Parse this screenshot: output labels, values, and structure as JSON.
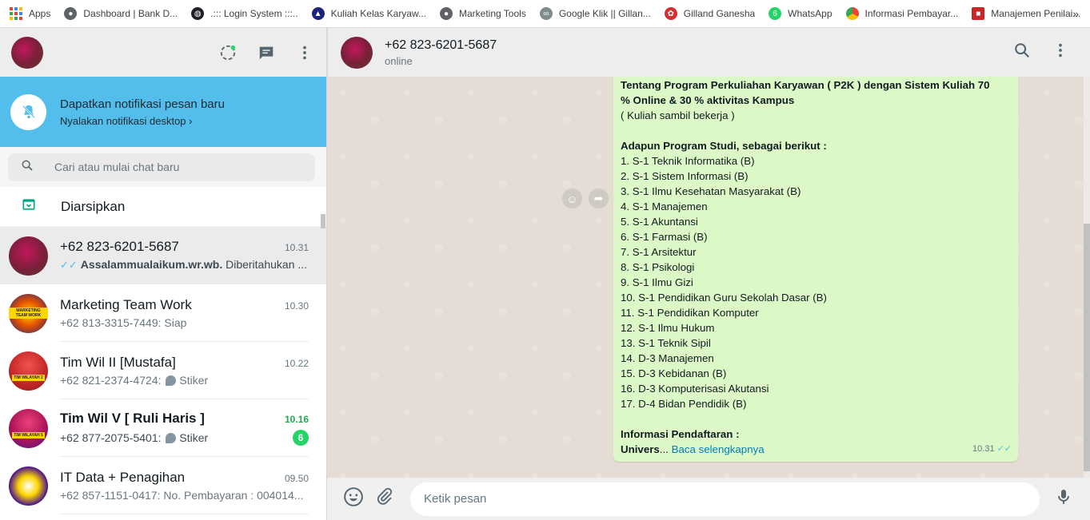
{
  "bookmarks": {
    "apps_label": "Apps",
    "items": [
      {
        "label": "Dashboard | Bank D...",
        "icon": "hat-icon",
        "color": "#5f6368"
      },
      {
        "label": ".::: Login System :::..",
        "icon": "globe-icon",
        "color": "#202124"
      },
      {
        "label": "Kuliah Kelas Karyaw...",
        "icon": "mortarboard-icon",
        "color": "#1a237e"
      },
      {
        "label": "Marketing Tools",
        "icon": "hat-icon",
        "color": "#5f6368"
      },
      {
        "label": "Google Klik || Gillan...",
        "icon": "binoculars-icon",
        "color": "#7e8c8d"
      },
      {
        "label": "Gilland Ganesha",
        "icon": "ganesha-logo-icon",
        "color": "#d32f2f"
      },
      {
        "label": "WhatsApp",
        "icon": "whatsapp-icon",
        "color": "#25d366"
      },
      {
        "label": "Informasi Pembayar...",
        "icon": "chrome-icon",
        "color": "#e53935"
      },
      {
        "label": "Manajemen Penilai...",
        "icon": "flag-icon",
        "color": "#c62828"
      }
    ],
    "more": "»"
  },
  "sidebar": {
    "notification": {
      "title": "Dapatkan notifikasi pesan baru",
      "link": "Nyalakan notifikasi desktop ›"
    },
    "search": {
      "placeholder": "Cari atau mulai chat baru"
    },
    "archived_label": "Diarsipkan",
    "chats": [
      {
        "name": "+62 823-6201-5687",
        "time": "10.31",
        "ticks": "✓✓",
        "preview_bold": "Assalammualaikum.wr.wb.",
        "preview": " Diberitahukan ...",
        "avatar_color": "#8a3a4a"
      },
      {
        "name": "Marketing Team Work",
        "time": "10.30",
        "preview": "+62 813-3315-7449: Siap",
        "avatar_text": "MARKETING TEAM WORK",
        "avatar_color": "#e65100"
      },
      {
        "name": "Tim Wil II [Mustafa]",
        "time": "10.22",
        "preview_prefix": "+62 821-2374-4724:",
        "preview": "Stiker",
        "avatar_text": "TIM WILAYAH 2",
        "avatar_color": "#c62828"
      },
      {
        "name": "Tim Wil V [ Ruli Haris ]",
        "time": "10.16",
        "preview_prefix": "+62 877-2075-5401:",
        "preview": "Stiker",
        "unread": "6",
        "avatar_text": "TIM WILAYAH 5",
        "avatar_color": "#ad1457"
      },
      {
        "name": "IT Data + Penagihan",
        "time": "09.50",
        "preview": "+62 857-1151-0417: No. Pembayaran : 004014...",
        "avatar_color": "#4a148c"
      }
    ]
  },
  "conversation": {
    "name": "+62 823-6201-5687",
    "status": "online",
    "message": {
      "lines": [
        {
          "text": "Tentang Program Perkuliahan Karyawan ( P2K ) dengan  Sistem Kuliah 70",
          "bold": true
        },
        {
          "text": "%  Online & 30 % aktivitas Kampus",
          "bold": true
        },
        {
          "text": "( Kuliah sambil bekerja )"
        },
        {
          "text": ""
        },
        {
          "text": "Adapun Program Studi, sebagai berikut :",
          "bold": true
        },
        {
          "text": "1. S-1 Teknik Informatika (B)"
        },
        {
          "text": "2. S-1 Sistem Informasi (B)"
        },
        {
          "text": "3. S-1 Ilmu Kesehatan Masyarakat (B)"
        },
        {
          "text": "4. S-1 Manajemen"
        },
        {
          "text": "5. S-1 Akuntansi"
        },
        {
          "text": "6. S-1 Farmasi (B)"
        },
        {
          "text": "7. S-1 Arsitektur"
        },
        {
          "text": "8. S-1 Psikologi"
        },
        {
          "text": "9. S-1 Ilmu Gizi"
        },
        {
          "text": "10. S-1 Pendidikan Guru Sekolah Dasar (B)"
        },
        {
          "text": "11. S-1 Pendidikan Komputer"
        },
        {
          "text": "12. S-1 Ilmu Hukum"
        },
        {
          "text": "13. S-1 Teknik Sipil"
        },
        {
          "text": "14. D-3 Manajemen"
        },
        {
          "text": "15. D-3 Kebidanan (B)"
        },
        {
          "text": "16. D-3 Komputerisasi Akutansi"
        },
        {
          "text": "17. D-4 Bidan Pendidik (B)"
        },
        {
          "text": ""
        },
        {
          "text": "Informasi Pendaftaran :",
          "bold": true
        }
      ],
      "last_bold": "Univers",
      "ellipsis": "...",
      "read_more": "Baca selengkapnya",
      "time": "10.31",
      "ticks": "✓✓"
    },
    "composer_placeholder": "Ketik pesan"
  },
  "colors": {
    "notification_bg": "#53bdeb",
    "bubble_out": "#dcf8c6",
    "accent_green": "#25d366",
    "read_tick": "#53bdeb"
  }
}
